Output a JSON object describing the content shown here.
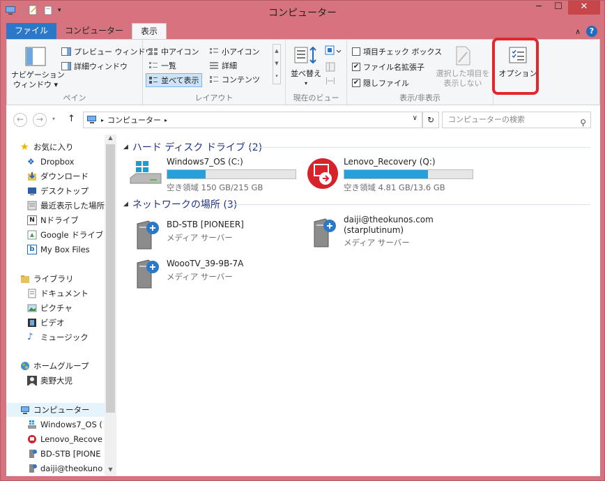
{
  "window": {
    "title": "コンピューター"
  },
  "tabs": [
    {
      "label": "ファイル"
    },
    {
      "label": "コンピューター"
    },
    {
      "label": "表示"
    }
  ],
  "ribbon": {
    "pane": {
      "nav_pane": "ナビゲーション\nウィンドウ ▾",
      "preview": "プレビュー ウィンドウ",
      "details": "詳細ウィンドウ",
      "label": "ペイン"
    },
    "layout": {
      "medium_icons": "中アイコン",
      "small_icons": "小アイコン",
      "list": "一覧",
      "details": "詳細",
      "tiles": "並べて表示",
      "content": "コンテンツ",
      "label": "レイアウト"
    },
    "current_view": {
      "sort": "並べ替え",
      "label": "現在のビュー"
    },
    "show_hide": {
      "item_checkbox": "項目チェック ボックス",
      "file_ext": "ファイル名拡張子",
      "hidden_files": "隠しファイル",
      "hide_selected": "選択した項目を\n表示しない",
      "label": "表示/非表示"
    },
    "options": {
      "label": "オプション"
    }
  },
  "address": {
    "path": "コンピューター",
    "search_placeholder": "コンピューターの検索"
  },
  "navpane": {
    "favorites": "お気に入り",
    "fav_items": [
      "Dropbox",
      "ダウンロード",
      "デスクトップ",
      "最近表示した場所",
      "Nドライブ",
      "Google ドライブ",
      "My Box Files"
    ],
    "libraries": "ライブラリ",
    "lib_items": [
      "ドキュメント",
      "ピクチャ",
      "ビデオ",
      "ミュージック"
    ],
    "homegroup": "ホームグループ",
    "user": "奥野大児",
    "computer": "コンピューター",
    "computer_items": [
      "Windows7_OS (",
      "Lenovo_Recove",
      "BD-STB [PIONE",
      "daiji@theokuno"
    ]
  },
  "content": {
    "hdd_header": "ハード ディスク ドライブ (2)",
    "drives": [
      {
        "name": "Windows7_OS (C:)",
        "free": "空き領域 150 GB/215 GB",
        "used_fraction": 0.3
      },
      {
        "name": "Lenovo_Recovery (Q:)",
        "free": "空き領域 4.81 GB/13.6 GB",
        "used_fraction": 0.65
      }
    ],
    "net_header": "ネットワークの場所 (3)",
    "network": [
      {
        "name": "BD-STB [PIONEER]",
        "sub": "メディア サーバー"
      },
      {
        "name": "daiji@theokunos.com\n(starplutinum)",
        "sub": "メディア サーバー"
      },
      {
        "name": "WoooTV_39-9B-7A",
        "sub": "メディア サーバー"
      }
    ]
  },
  "colors": {
    "accent": "#2b78c9",
    "frame": "#d7737e",
    "highlight": "#e2262c",
    "bar": "#26a0da"
  }
}
